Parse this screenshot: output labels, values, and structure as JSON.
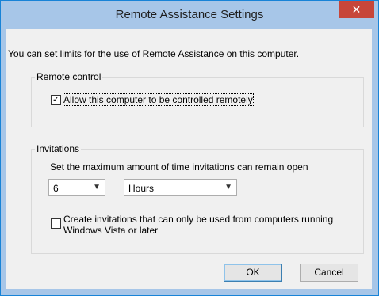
{
  "window": {
    "title": "Remote Assistance Settings",
    "close_icon_glyph": "✕"
  },
  "intro_text": "You can set limits for the use of Remote Assistance on this computer.",
  "remote_control": {
    "legend": "Remote control",
    "allow_label": "Allow this computer to be controlled remotely",
    "allow_checked": true
  },
  "invitations": {
    "legend": "Invitations",
    "max_time_label": "Set the maximum amount of time invitations can remain open",
    "amount_value": "6",
    "unit_value": "Hours",
    "vista_label_line1": "Create invitations that can only be used from computers running",
    "vista_label_line2": "Windows Vista or later",
    "vista_checked": false
  },
  "buttons": {
    "ok": "OK",
    "cancel": "Cancel"
  },
  "colors": {
    "titlebar": "#a7c6e8",
    "close": "#c7463a",
    "client": "#f0f0f0"
  }
}
